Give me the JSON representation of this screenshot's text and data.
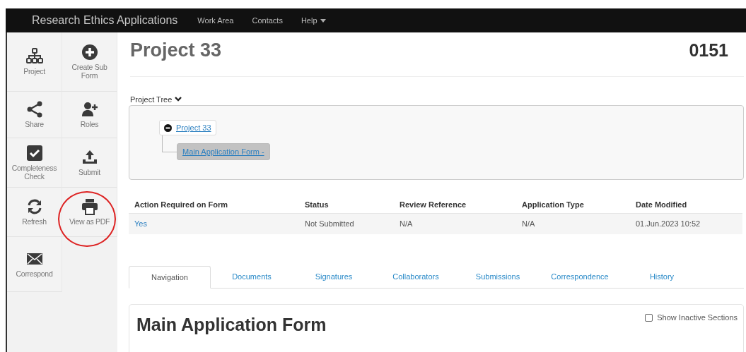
{
  "header": {
    "title": "Research Ethics Applications",
    "nav": [
      {
        "label": "Work Area",
        "dropdown": false
      },
      {
        "label": "Contacts",
        "dropdown": false
      },
      {
        "label": "Help",
        "dropdown": true
      }
    ]
  },
  "sidebar": {
    "items": [
      {
        "label": "Project",
        "circled": false
      },
      {
        "label": "Create Sub Form",
        "circled": false
      },
      {
        "label": "Share",
        "circled": false
      },
      {
        "label": "Roles",
        "circled": false
      },
      {
        "label": "Completeness Check",
        "circled": false
      },
      {
        "label": "Submit",
        "circled": false
      },
      {
        "label": "Refresh",
        "circled": false
      },
      {
        "label": "View as PDF",
        "circled": true
      },
      {
        "label": "Correspond",
        "circled": false
      }
    ]
  },
  "page": {
    "title": "Project 33",
    "number": "0151"
  },
  "project_tree": {
    "label": "Project Tree",
    "expanded": true,
    "nodes": [
      {
        "label": "Project 33",
        "expanded": true,
        "selected": false,
        "children": [
          {
            "label": "Main Application Form -",
            "selected": true
          }
        ]
      }
    ]
  },
  "table": {
    "columns": [
      "Action Required on Form",
      "Status",
      "Review Reference",
      "Application Type",
      "Date Modified"
    ],
    "rows": [
      [
        {
          "text": "Yes",
          "link": true
        },
        {
          "text": "Not Submitted",
          "link": false
        },
        {
          "text": "N/A",
          "link": false
        },
        {
          "text": "N/A",
          "link": false
        },
        {
          "text": "01.Jun.2023 10:52",
          "link": false
        }
      ]
    ]
  },
  "tabs": [
    {
      "label": "Navigation",
      "selected": true
    },
    {
      "label": "Documents",
      "selected": false
    },
    {
      "label": "Signatures",
      "selected": false
    },
    {
      "label": "Collaborators",
      "selected": false
    },
    {
      "label": "Submissions",
      "selected": false
    },
    {
      "label": "Correspondence",
      "selected": false
    },
    {
      "label": "History",
      "selected": false
    }
  ],
  "form": {
    "title": "Main Application Form",
    "show_inactive": {
      "label": "Show Inactive Sections",
      "checked": false
    }
  }
}
